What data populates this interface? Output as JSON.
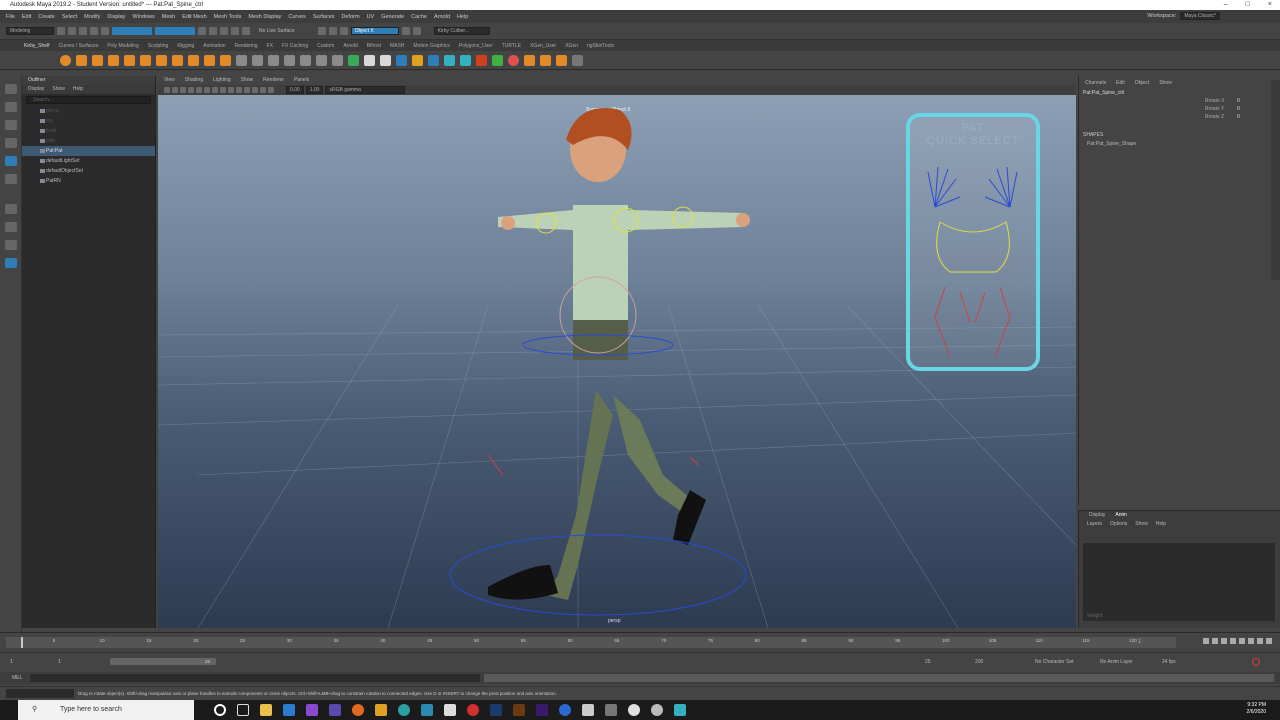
{
  "window": {
    "title": "Autodesk Maya 2019.2 - Student Version: untitled*  ---  Pat:Pat_Spine_ctrl"
  },
  "menubar": {
    "items": [
      "File",
      "Edit",
      "Create",
      "Select",
      "Modify",
      "Display",
      "Windows",
      "Mesh",
      "Edit Mesh",
      "Mesh Tools",
      "Mesh Display",
      "Curves",
      "Surfaces",
      "Deform",
      "UV",
      "Generate",
      "Cache",
      "Arnold",
      "Help"
    ],
    "workspace_label": "Workspace:",
    "workspace_value": "Maya Classic*"
  },
  "statusline": {
    "mode": "Modeling",
    "live_surface": "No Live Surface",
    "symmetry": "Object X",
    "user": "Kirby Culber..."
  },
  "shelf": {
    "tabs": [
      "Kirby_Shelf",
      "Curves / Surfaces",
      "Poly Modeling",
      "Sculpting",
      "Rigging",
      "Animation",
      "Rendering",
      "FX",
      "FX Caching",
      "Custom",
      "Arnold",
      "Bifrost",
      "MASH",
      "Motion Graphics",
      "Polygons_User",
      "TURTLE",
      "XGen_User",
      "XGen",
      "ngSkinTools"
    ],
    "active_tab": "Kirby_Shelf"
  },
  "outliner": {
    "title": "Outliner",
    "menu": [
      "Display",
      "Show",
      "Help"
    ],
    "search_placeholder": "Search...",
    "items": [
      {
        "label": "persp",
        "state": "dim"
      },
      {
        "label": "top",
        "state": "dim"
      },
      {
        "label": "front",
        "state": "dim"
      },
      {
        "label": "side",
        "state": "dim"
      },
      {
        "label": "Pat:Pat",
        "state": "sel"
      },
      {
        "label": "defaultLightSet",
        "state": "normal"
      },
      {
        "label": "defaultObjectSet",
        "state": "normal"
      },
      {
        "label": "PatRN",
        "state": "normal"
      }
    ]
  },
  "viewport": {
    "menu": [
      "View",
      "Shading",
      "Lighting",
      "Show",
      "Renderer",
      "Panels"
    ],
    "field1": "0.00",
    "field2": "1.00",
    "colorspace": "sRGB gamma",
    "symmetry_label": "Symmetry: Object X",
    "camera": "persp",
    "quick_select_line1": "PAT",
    "quick_select_line2": "QUICK SELECT"
  },
  "channelbox": {
    "menu": [
      "Channels",
      "Edit",
      "Object",
      "Show"
    ],
    "object": "Pat:Pat_Spine_ctrl",
    "attributes": [
      {
        "name": "Rotate X",
        "value": "0"
      },
      {
        "name": "Rotate Y",
        "value": "0"
      },
      {
        "name": "Rotate Z",
        "value": "0"
      }
    ],
    "shapes_label": "SHAPES",
    "shape_name": "Pat:Pat_Spine_Shape"
  },
  "layers": {
    "tabs": [
      "Display",
      "Anim"
    ],
    "active_tab": "Anim",
    "menu": [
      "Layers",
      "Options",
      "Show",
      "Help"
    ],
    "weight_label": "Weight"
  },
  "timeslider": {
    "ticks": [
      "5",
      "10",
      "15",
      "20",
      "25",
      "30",
      "35",
      "40",
      "45",
      "50",
      "55",
      "60",
      "65",
      "70",
      "75",
      "80",
      "85",
      "90",
      "95",
      "100",
      "105",
      "110",
      "115",
      "120"
    ],
    "current_frame": "1"
  },
  "rangebar": {
    "start": "1",
    "start_inner": "1",
    "range_end_inner": "25",
    "end": "25",
    "end_outer": "200",
    "character_set": "No Character Set",
    "anim_layer": "No Anim Layer",
    "fps": "24 fps"
  },
  "cmdline": {
    "label": "MEL"
  },
  "helpline": {
    "text": "Drag to rotate object(s). Shift+drag manipulator axis or plane handles to extrude components or clone objects. Ctrl+Shift+LMB+drag to constrain rotation to connected edges. Use D or INSERT to change the pivot position and axis orientation."
  },
  "taskbar": {
    "search_placeholder": "Type here to search",
    "time": "9:32 PM",
    "date": "2/6/2020"
  },
  "colors": {
    "accent_blue": "#2e7fb8",
    "quick_select_border": "#69d6e6"
  }
}
